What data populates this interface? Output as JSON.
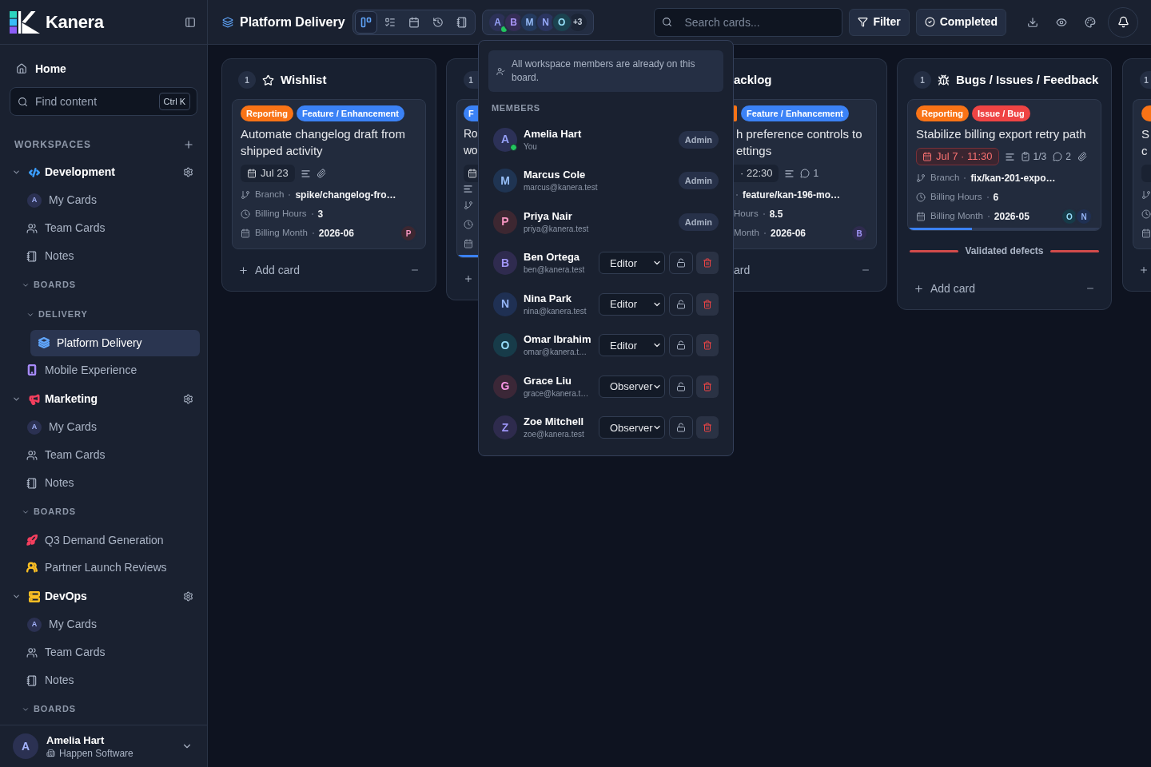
{
  "sidebar": {
    "brand": "Kanera",
    "home": "Home",
    "search": {
      "placeholder": "Find content",
      "shortcut": "Ctrl K"
    },
    "workspaces_label": "WORKSPACES",
    "workspaces": [
      {
        "name": "Development",
        "color": "#3b9eff",
        "expanded": true,
        "items": [
          {
            "kind": "mine",
            "label": "My Cards",
            "avatar": "A"
          },
          {
            "kind": "team",
            "label": "Team Cards"
          },
          {
            "kind": "notes",
            "label": "Notes"
          }
        ],
        "boards": {
          "label": "BOARDS",
          "expanded": true,
          "children": [
            {
              "kind": "group",
              "label": "DELIVERY",
              "expanded": true,
              "children": [
                {
                  "kind": "board",
                  "label": "Platform Delivery",
                  "color": "#60a5fa",
                  "selected": true
                }
              ]
            },
            {
              "kind": "board",
              "label": "Mobile Experience",
              "color": "#a78bfa",
              "selected": false
            }
          ]
        }
      },
      {
        "name": "Marketing",
        "color": "#f43f5e",
        "expanded": true,
        "items": [
          {
            "kind": "mine",
            "label": "My Cards",
            "avatar": "A"
          },
          {
            "kind": "team",
            "label": "Team Cards"
          },
          {
            "kind": "notes",
            "label": "Notes"
          }
        ],
        "boards": {
          "label": "BOARDS",
          "expanded": true,
          "children": [
            {
              "kind": "board",
              "label": "Q3 Demand Generation",
              "color": "#f43f5e",
              "selected": false
            },
            {
              "kind": "board",
              "label": "Partner Launch Reviews",
              "color": "#fbbf24",
              "selected": false
            }
          ]
        }
      },
      {
        "name": "DevOps",
        "color": "#fbbf24",
        "expanded": true,
        "items": [
          {
            "kind": "mine",
            "label": "My Cards",
            "avatar": "A"
          },
          {
            "kind": "team",
            "label": "Team Cards"
          },
          {
            "kind": "notes",
            "label": "Notes"
          }
        ],
        "boards": {
          "label": "BOARDS",
          "expanded": true
        }
      }
    ],
    "user": {
      "avatar": "A",
      "name": "Amelia Hart",
      "org": "Happen Software"
    }
  },
  "top_bar": {
    "title": "Platform Delivery",
    "views": [
      {
        "selected": true
      },
      {
        "selected": false
      },
      {
        "selected": false
      },
      {
        "selected": false
      },
      {
        "selected": false
      }
    ],
    "members": [
      {
        "initial": "A",
        "color": "#2c3157",
        "online": true
      },
      {
        "initial": "B",
        "color": "#352d56",
        "online": false
      },
      {
        "initial": "M",
        "color": "#243a5e",
        "online": false
      },
      {
        "initial": "N",
        "color": "#2b3560",
        "online": false
      },
      {
        "initial": "O",
        "color": "#1b4350",
        "online": false
      }
    ],
    "more_members": "+3",
    "search": {
      "placeholder": "Search cards..."
    },
    "filter": "Filter",
    "completed": "Completed"
  },
  "board": {
    "columns": [
      {
        "kind": "full",
        "count": "1",
        "title": "Wishlist",
        "cards": [
          {
            "tags": [
              {
                "label": "Reporting",
                "color": "#f97316"
              },
              {
                "label": "Feature / Enhancement",
                "color": "#3b82f6"
              }
            ],
            "title": "Automate changelog draft from shipped activity",
            "due": {
              "label": "Jul 23",
              "overdue": false
            },
            "description": true,
            "attachment": true,
            "fields": [
              {
                "kind": "branch",
                "label": "Branch",
                "value": "spike/changelog-fro…"
              },
              {
                "kind": "hours",
                "label": "Billing Hours",
                "value": "3"
              },
              {
                "kind": "month",
                "label": "Billing Month",
                "value": "2026-06"
              }
            ],
            "assignees": [
              {
                "initial": "P",
                "color": "#3d2731"
              }
            ]
          }
        ],
        "add_card": "Add card"
      },
      {
        "kind": "cut_right",
        "count": "1",
        "cards": [
          {
            "tags": [
              {
                "label": "F",
                "color": "#3b82f6"
              }
            ],
            "title_lines": [
              "Ro",
              "wo"
            ],
            "due": {
              "overdue": false
            },
            "description": true,
            "fields": [
              {
                "kind": "branch"
              },
              {
                "kind": "hours"
              },
              {
                "kind": "month"
              }
            ],
            "progress_bar": true
          }
        ],
        "add_card": true
      },
      {
        "kind": "cut_left",
        "title": "acklog",
        "cards": [
          {
            "tags": [
              {
                "color": "#f97316"
              },
              {
                "label": "Feature / Enhancement",
                "color": "#3b82f6"
              }
            ],
            "title_lines": [
              "h preference controls to",
              "ettings"
            ],
            "due": {
              "label": "· 22:30",
              "overdue": false
            },
            "description": true,
            "comments": "1",
            "fields": [
              {
                "kind": "branch",
                "value": "feature/kan-196-mo…"
              },
              {
                "kind": "hours",
                "label": "Hours",
                "value": "8.5"
              },
              {
                "kind": "month",
                "label": "Month",
                "value": "2026-06"
              }
            ],
            "assignees": [
              {
                "initial": "B",
                "color": "#2f2b4f"
              }
            ]
          }
        ],
        "add_card": "ard"
      },
      {
        "kind": "full",
        "count": "1",
        "title": "Bugs / Issues / Feedback",
        "cards": [
          {
            "tags": [
              {
                "label": "Reporting",
                "color": "#f97316"
              },
              {
                "label": "Issue / Bug",
                "color": "#ef4444"
              }
            ],
            "title": "Stabilize billing export retry path",
            "due": {
              "label": "Jul 7 · 11:30",
              "overdue": true
            },
            "description": true,
            "checklist": "1/3",
            "comments": "2",
            "attachment": true,
            "fields": [
              {
                "kind": "branch",
                "label": "Branch",
                "value": "fix/kan-201-expo…"
              },
              {
                "kind": "hours",
                "label": "Billing Hours",
                "value": "6"
              },
              {
                "kind": "month",
                "label": "Billing Month",
                "value": "2026-05"
              }
            ],
            "assignees": [
              {
                "initial": "O",
                "color": "#173b49"
              },
              {
                "initial": "N",
                "color": "#1f3053"
              }
            ],
            "progress": {
              "level": 0.33
            }
          }
        ],
        "section": "Validated defects",
        "add_card": "Add card"
      },
      {
        "kind": "cut_edge",
        "count": "1",
        "cards": [
          {
            "tags": [
              {
                "color": "#f97316"
              }
            ],
            "title_lines": [
              "S",
              "c"
            ],
            "due": {
              "overdue": false
            },
            "fields": [
              {
                "kind": "branch"
              },
              {
                "kind": "hours"
              },
              {
                "kind": "month"
              }
            ]
          }
        ],
        "add_card": true
      }
    ]
  },
  "members_popover": {
    "notice": "All workspace members are already on this board.",
    "section": "MEMBERS",
    "members": [
      {
        "kind": "fixed",
        "initial": "A",
        "color": "#2c3157",
        "online": true,
        "name": "Amelia Hart",
        "detail": "You",
        "role": "Admin"
      },
      {
        "kind": "fixed",
        "initial": "M",
        "color": "#1f3452",
        "online": false,
        "name": "Marcus Cole",
        "detail": "marcus@kanera.test",
        "role": "Admin"
      },
      {
        "kind": "fixed",
        "initial": "P",
        "color": "#3d2731",
        "online": false,
        "name": "Priya Nair",
        "detail": "priya@kanera.test",
        "role": "Admin"
      },
      {
        "kind": "editable",
        "initial": "B",
        "color": "#2f2b4f",
        "online": false,
        "name": "Ben Ortega",
        "detail": "ben@kanera.test",
        "role": "Editor"
      },
      {
        "kind": "editable",
        "initial": "N",
        "color": "#1f3053",
        "online": false,
        "name": "Nina Park",
        "detail": "nina@kanera.test",
        "role": "Editor"
      },
      {
        "kind": "editable",
        "initial": "O",
        "color": "#173b49",
        "online": false,
        "name": "Omar Ibrahim",
        "detail": "omar@kanera.t…",
        "role": "Editor"
      },
      {
        "kind": "editable",
        "initial": "G",
        "color": "#3b2737",
        "online": false,
        "name": "Grace Liu",
        "detail": "grace@kanera.t…",
        "role": "Observer"
      },
      {
        "kind": "editable",
        "initial": "Z",
        "color": "#2e2b4d",
        "online": false,
        "name": "Zoe Mitchell",
        "detail": "zoe@kanera.test",
        "role": "Observer"
      }
    ]
  }
}
